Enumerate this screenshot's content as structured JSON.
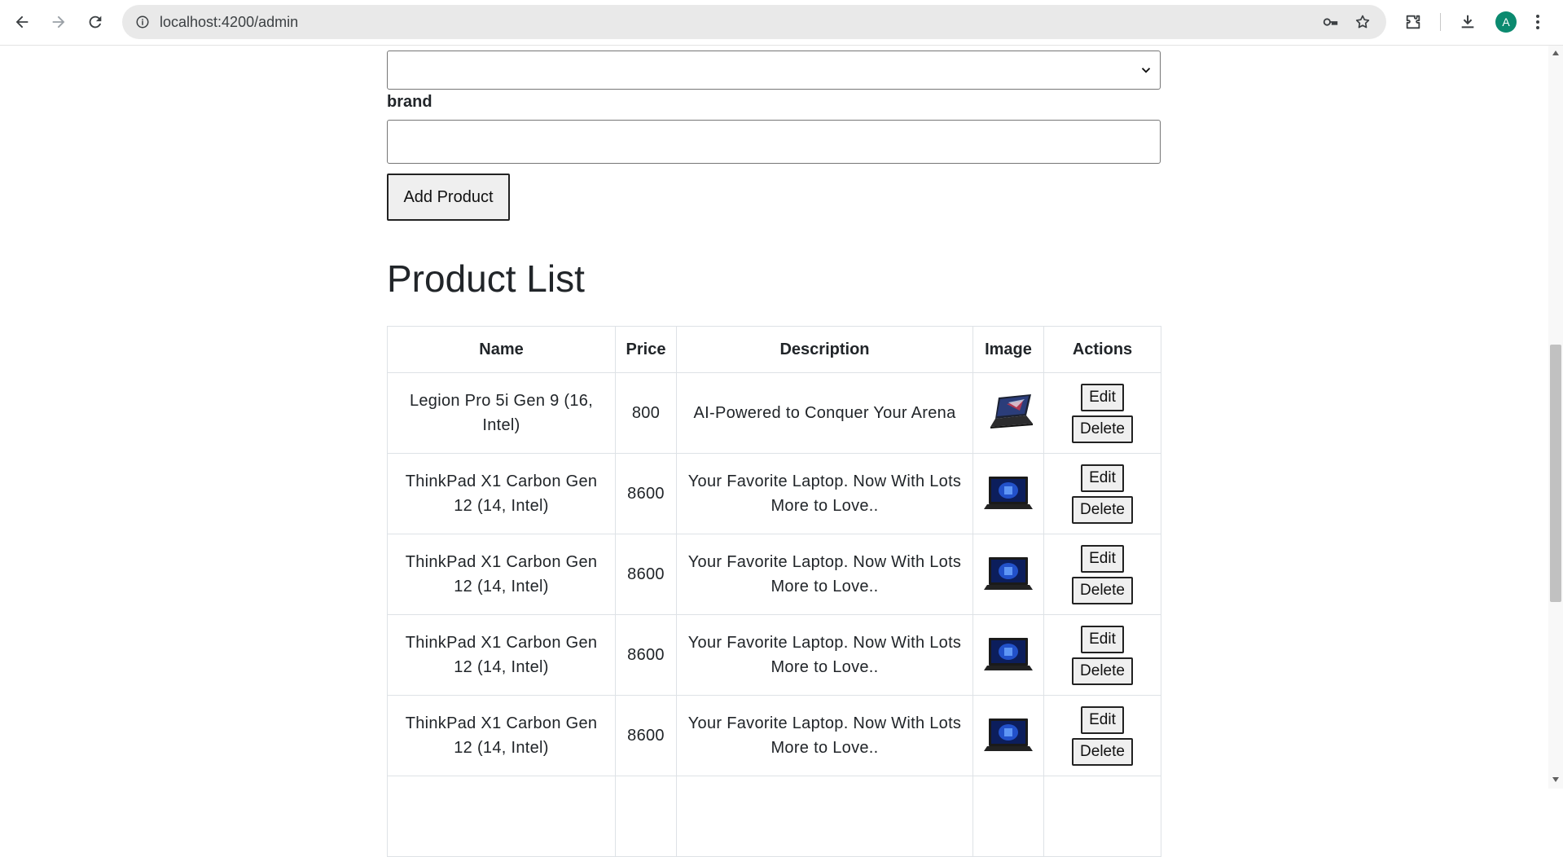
{
  "browser": {
    "url": "localhost:4200/admin",
    "profile_initial": "A",
    "icons": [
      "back-icon",
      "forward-icon",
      "reload-icon",
      "info-icon",
      "key-icon",
      "star-icon",
      "extensions-icon",
      "download-icon",
      "more-icon"
    ]
  },
  "form": {
    "select_value": "",
    "brand_label": "brand",
    "brand_value": "",
    "add_button": "Add Product"
  },
  "product_list": {
    "title": "Product List",
    "columns": [
      "Name",
      "Price",
      "Description",
      "Image",
      "Actions"
    ],
    "rows": [
      {
        "name": "Legion Pro 5i Gen 9 (16, Intel)",
        "price": "800",
        "description": "AI-Powered to Conquer Your Arena",
        "image": "laptop-gaming-icon"
      },
      {
        "name": "ThinkPad X1 Carbon Gen 12 (14, Intel)",
        "price": "8600",
        "description": "Your Favorite Laptop. Now With Lots More to Love..",
        "image": "laptop-thinkpad-icon"
      },
      {
        "name": "ThinkPad X1 Carbon Gen 12 (14, Intel)",
        "price": "8600",
        "description": "Your Favorite Laptop. Now With Lots More to Love..",
        "image": "laptop-thinkpad-icon"
      },
      {
        "name": "ThinkPad X1 Carbon Gen 12 (14, Intel)",
        "price": "8600",
        "description": "Your Favorite Laptop. Now With Lots More to Love..",
        "image": "laptop-thinkpad-icon"
      },
      {
        "name": "ThinkPad X1 Carbon Gen 12 (14, Intel)",
        "price": "8600",
        "description": "Your Favorite Laptop. Now With Lots More to Love..",
        "image": "laptop-thinkpad-icon"
      }
    ],
    "edit_label": "Edit",
    "delete_label": "Delete"
  }
}
